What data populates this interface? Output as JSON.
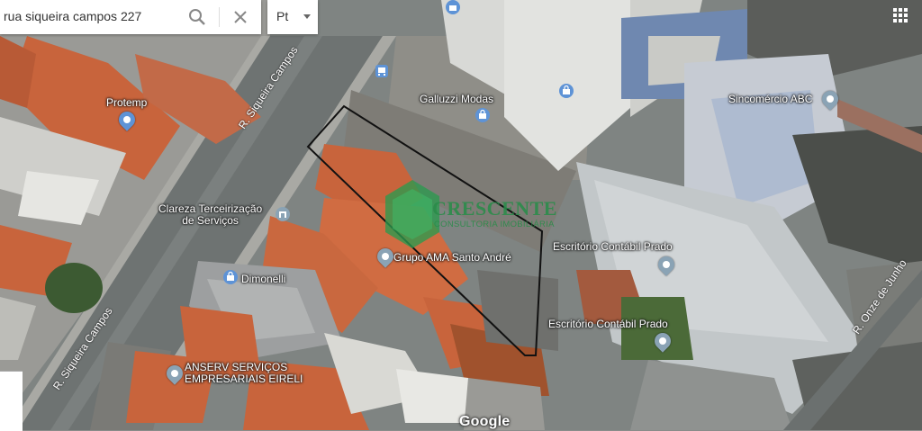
{
  "search": {
    "query": "rua siqueira campos 227"
  },
  "language": {
    "selected": "Pt"
  },
  "streets": {
    "siqueira_1": "R. Siqueira Campos",
    "siqueira_2": "R. Siqueira Campos",
    "onze_de_junho": "R. Onze de Junho"
  },
  "places": {
    "protemp": "Protemp",
    "galluzzi": "Galluzzi Modas",
    "sincomercio": "Sincomércio ABC",
    "clareza_1": "Clareza Terceirização",
    "clareza_2": "de Serviços",
    "grupo_ama": "Grupo AMA Santo André",
    "dimonelli": "Dimonelli",
    "contabil_1": "Escritório Contábil Prado",
    "contabil_2": "Escritório Contábil Prado",
    "anserv_1": "ANSERV SERVIÇOS",
    "anserv_2": "EMPRESARIAIS EIRELI"
  },
  "watermark": {
    "title": "CRESCENTE",
    "subtitle": "CONSULTORIA IMOBILIÁRIA"
  },
  "attribution": "Google",
  "colors": {
    "roof_tile": "#c8643c",
    "pin_blue": "#5e93d6",
    "watermark_green": "#2a8c4a",
    "outline": "#111111"
  },
  "icons": [
    "search-icon",
    "close-icon",
    "apps-grid-icon",
    "location-pin-icon",
    "shopping-bag-icon",
    "bus-stop-icon"
  ]
}
